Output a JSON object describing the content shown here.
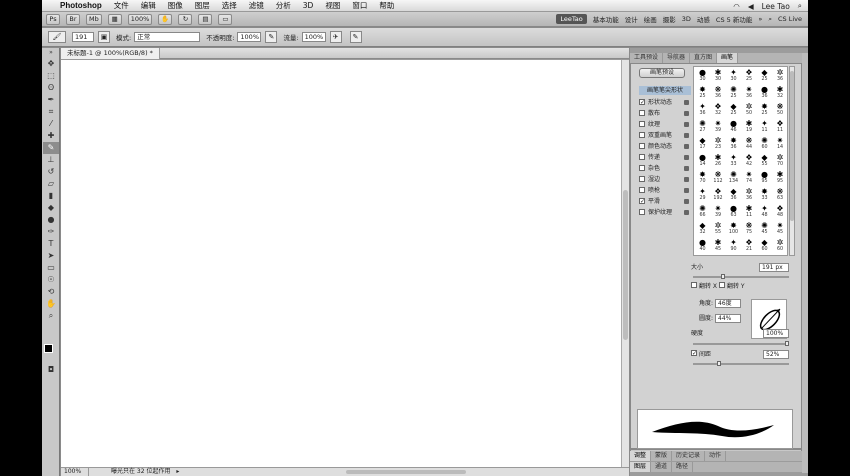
{
  "menubar": {
    "apple_glyph": "",
    "app": "Photoshop",
    "items": [
      "文件",
      "编辑",
      "图像",
      "图层",
      "选择",
      "滤镜",
      "分析",
      "3D",
      "视图",
      "窗口",
      "帮助"
    ],
    "user": "Lee Tao",
    "search_glyph": "⌕"
  },
  "appbar": {
    "zoom": "100%",
    "workspace_active": "LeeTao",
    "workspaces": [
      "基本功能",
      "设计",
      "绘画",
      "摄影",
      "3D",
      "动感",
      "CS 5 新功能"
    ],
    "cs_live": "CS Live"
  },
  "options": {
    "brush_size": "191",
    "mode_label": "模式:",
    "mode_value": "正常",
    "opacity_label": "不透明度:",
    "opacity_value": "100%",
    "flow_label": "流量:",
    "flow_value": "100%"
  },
  "document": {
    "tab_title": "未标题-1 @ 100%(RGB/8) *",
    "status_zoom": "100%",
    "status_info": "曝光只在 32 位起作用"
  },
  "panel_tabs": [
    "工具预设",
    "导航器",
    "直方图",
    "画笔"
  ],
  "panel_tab_active": 3,
  "brush": {
    "preset_button": "画笔预设",
    "categories": [
      {
        "label": "画笔笔尖形状",
        "checked": false,
        "highlight": true
      },
      {
        "label": "形状动态",
        "checked": true
      },
      {
        "label": "散布",
        "checked": false
      },
      {
        "label": "纹理",
        "checked": false
      },
      {
        "label": "双重画笔",
        "checked": false
      },
      {
        "label": "颜色动态",
        "checked": false
      },
      {
        "label": "传递",
        "checked": false
      },
      {
        "label": "杂色",
        "checked": false
      },
      {
        "label": "湿边",
        "checked": false
      },
      {
        "label": "喷枪",
        "checked": false
      },
      {
        "label": "平滑",
        "checked": true
      },
      {
        "label": "保护纹理",
        "checked": false
      }
    ],
    "tips": [
      [
        30,
        30,
        30,
        25,
        25,
        36
      ],
      [
        25,
        36,
        25,
        36,
        36,
        32
      ],
      [
        36,
        32,
        25,
        50,
        25,
        50
      ],
      [
        27,
        39,
        46,
        19,
        11,
        11
      ],
      [
        17,
        23,
        36,
        44,
        60,
        14
      ],
      [
        14,
        26,
        33,
        42,
        55,
        70
      ],
      [
        70,
        112,
        134,
        74,
        95,
        95
      ],
      [
        29,
        192,
        36,
        36,
        33,
        63
      ],
      [
        66,
        39,
        63,
        11,
        48,
        48
      ],
      [
        32,
        55,
        100,
        75,
        45,
        45
      ],
      [
        40,
        45,
        90,
        21,
        60,
        60
      ]
    ],
    "size_label": "大小",
    "size_value": "191 px",
    "flip_x": "翻转 X",
    "flip_y": "翻转 Y",
    "angle_label": "角度:",
    "angle_value": "46度",
    "roundness_label": "圆度:",
    "roundness_value": "44%",
    "hardness_label": "硬度",
    "hardness_value": "100%",
    "spacing_label": "间距",
    "spacing_value": "52%",
    "spacing_checked": true,
    "hardness_level": 1.0,
    "spacing_level": 0.26,
    "size_level": 0.3
  },
  "bottom_tabs_1": [
    "调整",
    "蒙版",
    "历史记录",
    "动作"
  ],
  "bottom_tabs_2": [
    "图层",
    "通道",
    "路径"
  ]
}
